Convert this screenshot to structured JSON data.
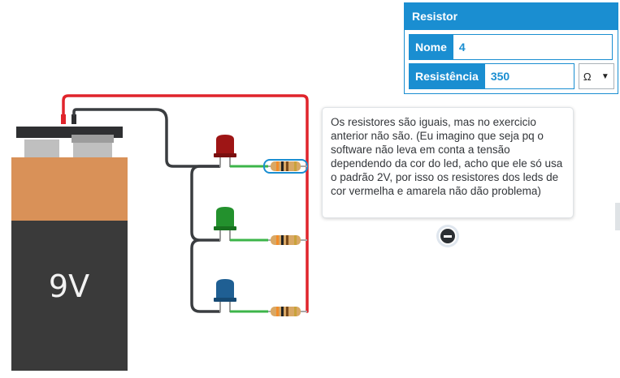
{
  "inspector": {
    "title": "Resistor",
    "name_label": "Nome",
    "name_value": "4",
    "resistance_label": "Resistência",
    "resistance_value": "350",
    "unit": "Ω"
  },
  "battery": {
    "label": "9V"
  },
  "comment": {
    "text": "Os resistores são iguais, mas no exercicio anterior não são. (Eu imagino que seja pq o software não leva em conta a tensão dependendo da cor do led, acho que ele só usa o padrão 2V, por isso os resistores dos leds de cor vermelha e amarela não dão problema)"
  },
  "colors": {
    "accent": "#1a8ed1",
    "wire_red": "#e0242b",
    "wire_black": "#3a3d40",
    "wire_green": "#3cb54a",
    "battery_top": "#d99158",
    "battery_body": "#3a3a3a",
    "led_red": "#9e1515",
    "led_green": "#23912d",
    "led_blue": "#1f5f93"
  }
}
